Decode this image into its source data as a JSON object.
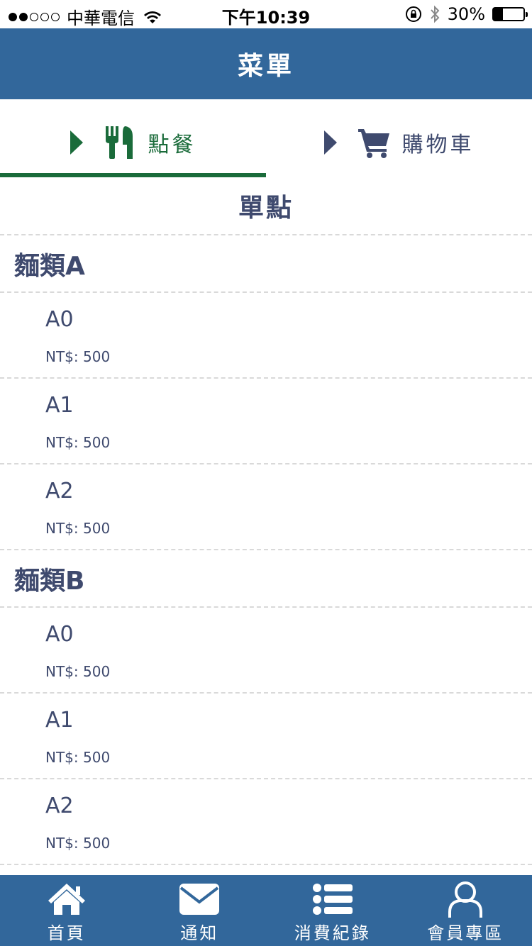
{
  "status_bar": {
    "carrier": "中華電信",
    "time": "下午10:39",
    "battery_text": "30%",
    "battery_level": 0.3,
    "signal_bars_filled": 2,
    "signal_bars_total": 5
  },
  "header": {
    "title": "菜單"
  },
  "tabs": [
    {
      "label": "點餐",
      "icon": "utensils-icon",
      "active": true
    },
    {
      "label": "購物車",
      "icon": "cart-icon",
      "active": false
    }
  ],
  "section_title": "單點",
  "categories": [
    {
      "name": "麵類A",
      "items": [
        {
          "name": "A0",
          "price": "NT$: 500"
        },
        {
          "name": "A1",
          "price": "NT$: 500"
        },
        {
          "name": "A2",
          "price": "NT$: 500"
        }
      ]
    },
    {
      "name": "麵類B",
      "items": [
        {
          "name": "A0",
          "price": "NT$: 500"
        },
        {
          "name": "A1",
          "price": "NT$: 500"
        },
        {
          "name": "A2",
          "price": "NT$: 500"
        }
      ]
    }
  ],
  "bottom_nav": [
    {
      "label": "首頁",
      "icon": "home-icon"
    },
    {
      "label": "通知",
      "icon": "mail-icon"
    },
    {
      "label": "消費紀錄",
      "icon": "list-icon"
    },
    {
      "label": "會員專區",
      "icon": "user-icon"
    }
  ],
  "colors": {
    "primary": "#32679b",
    "active_tab": "#1a6b3a",
    "text": "#3f4a6e",
    "divider": "#d9d9d9"
  }
}
